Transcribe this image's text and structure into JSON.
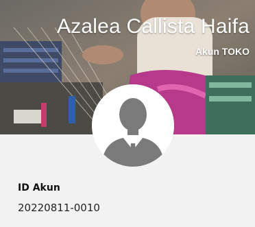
{
  "profile": {
    "name": "Azalea Callista Haifa",
    "account_type": "Akun TOKO",
    "id_label": "ID Akun",
    "id_value": "20220811-0010"
  },
  "icons": {
    "avatar": "default-user-silhouette-icon"
  },
  "colors": {
    "info_background": "#f2f2f2",
    "avatar_silhouette": "#7a7a7a",
    "text_primary": "#111111"
  }
}
